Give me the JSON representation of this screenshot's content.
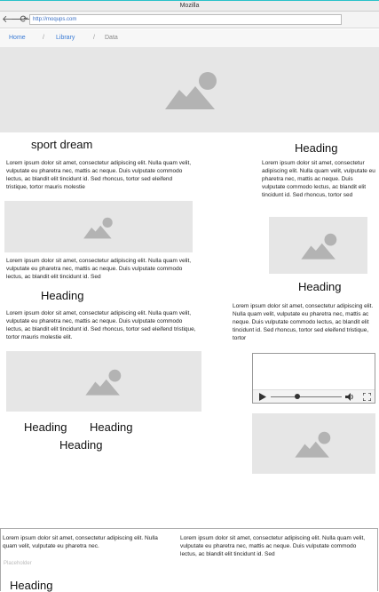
{
  "window": {
    "title": "Mozilla"
  },
  "browser": {
    "url": "http://moqups.com",
    "back_icon": "arrow-left-icon",
    "forward_icon": "arrow-right-icon",
    "reload_icon": "reload-icon"
  },
  "breadcrumb": {
    "items": [
      "Home",
      "Library",
      "Data"
    ],
    "separator": "/"
  },
  "content": {
    "sport_title": "sport dream",
    "heading": "Heading",
    "lorem_a": "Lorem ipsum dolor sit amet, consectetur adipiscing elit. Nulla quam velit, vulputate eu pharetra nec, mattis ac neque. Duis vulputate commodo lectus, ac blandit elit tincidunt id. Sed rhoncus, tortor sed eleifend tristique, tortor mauris molestie",
    "lorem_b": "Lorem ipsum dolor sit amet, consectetur adipiscing elit. Nulla quam velit, vulputate eu pharetra nec, mattis ac neque. Duis vulputate commodo lectus, ac blandit elit tincidunt id. Sed",
    "lorem_c": "Lorem ipsum dolor sit amet, consectetur adipiscing elit. Nulla quam velit, vulputate eu pharetra nec, mattis ac neque. Duis vulputate commodo lectus, ac blandit elit tincidunt id. Sed rhoncus, tortor sed eleifend tristique, tortor mauris molestie elit.",
    "lorem_right1": "Lorem ipsum dolor sit amet, consectetur adipiscing elit. Nulla quam velit, vulputate eu pharetra nec, mattis ac neque. Duis vulputate commodo lectus, ac blandit elit tincidunt id. Sed rhoncus, tortor sed",
    "lorem_right2": "Lorem ipsum dolor sit amet, consectetur adipiscing elit. Nulla quam velit, vulputate eu pharetra nec, mattis ac neque. Duis vulputate commodo lectus, ac blandit elit tincidunt id. Sed rhoncus, tortor sed eleifend tristique, tortor",
    "footer_left": "Lorem ipsum dolor sit amet, consectetur adipiscing elit. Nulla quam velit, vulputate eu pharetra nec.",
    "footer_right": "Lorem ipsum dolor sit amet, consectetur adipiscing elit. Nulla quam velit, vulputate eu pharetra nec, mattis ac neque. Duis vulputate commodo lectus, ac blandit elit tincidunt id. Sed",
    "placeholder_label": "Placeholder"
  },
  "video": {
    "play_icon": "play-icon",
    "volume_icon": "volume-icon",
    "fullscreen_icon": "fullscreen-icon",
    "progress": 0.38
  },
  "colors": {
    "accent": "#29c1c9",
    "link": "#3a7bd5",
    "placeholder_bg": "#e6e6e6",
    "image_icon": "#b3b3b3"
  }
}
